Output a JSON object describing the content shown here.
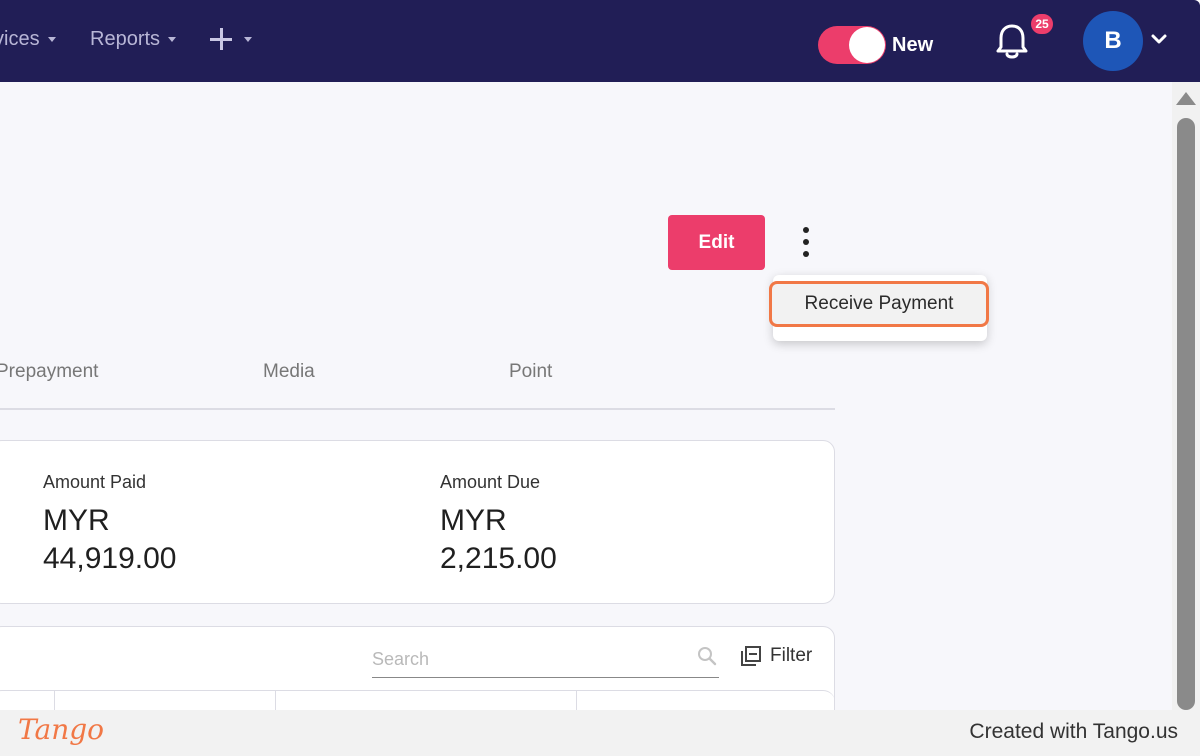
{
  "nav": {
    "items": [
      {
        "label": "vices"
      },
      {
        "label": "Reports"
      }
    ],
    "toggle_label": "New",
    "notification_count": "25",
    "avatar_initial": "B"
  },
  "actions": {
    "edit_label": "Edit",
    "menu_items": [
      {
        "label": "Receive Payment"
      }
    ]
  },
  "tabs": [
    {
      "label": "Prepayment"
    },
    {
      "label": "Media"
    },
    {
      "label": "Point"
    }
  ],
  "summary": {
    "amount_paid": {
      "label": "Amount Paid",
      "currency": "MYR",
      "value": "44,919.00"
    },
    "amount_due": {
      "label": "Amount Due",
      "currency": "MYR",
      "value": "2,215.00"
    }
  },
  "table": {
    "search_placeholder": "Search",
    "filter_label": "Filter"
  },
  "footer": {
    "logo": "Tango",
    "credit": "Created with Tango.us"
  },
  "colors": {
    "nav_bg": "#211e56",
    "accent": "#ec3d6b",
    "highlight": "#f17846",
    "avatar": "#1e56b7"
  }
}
